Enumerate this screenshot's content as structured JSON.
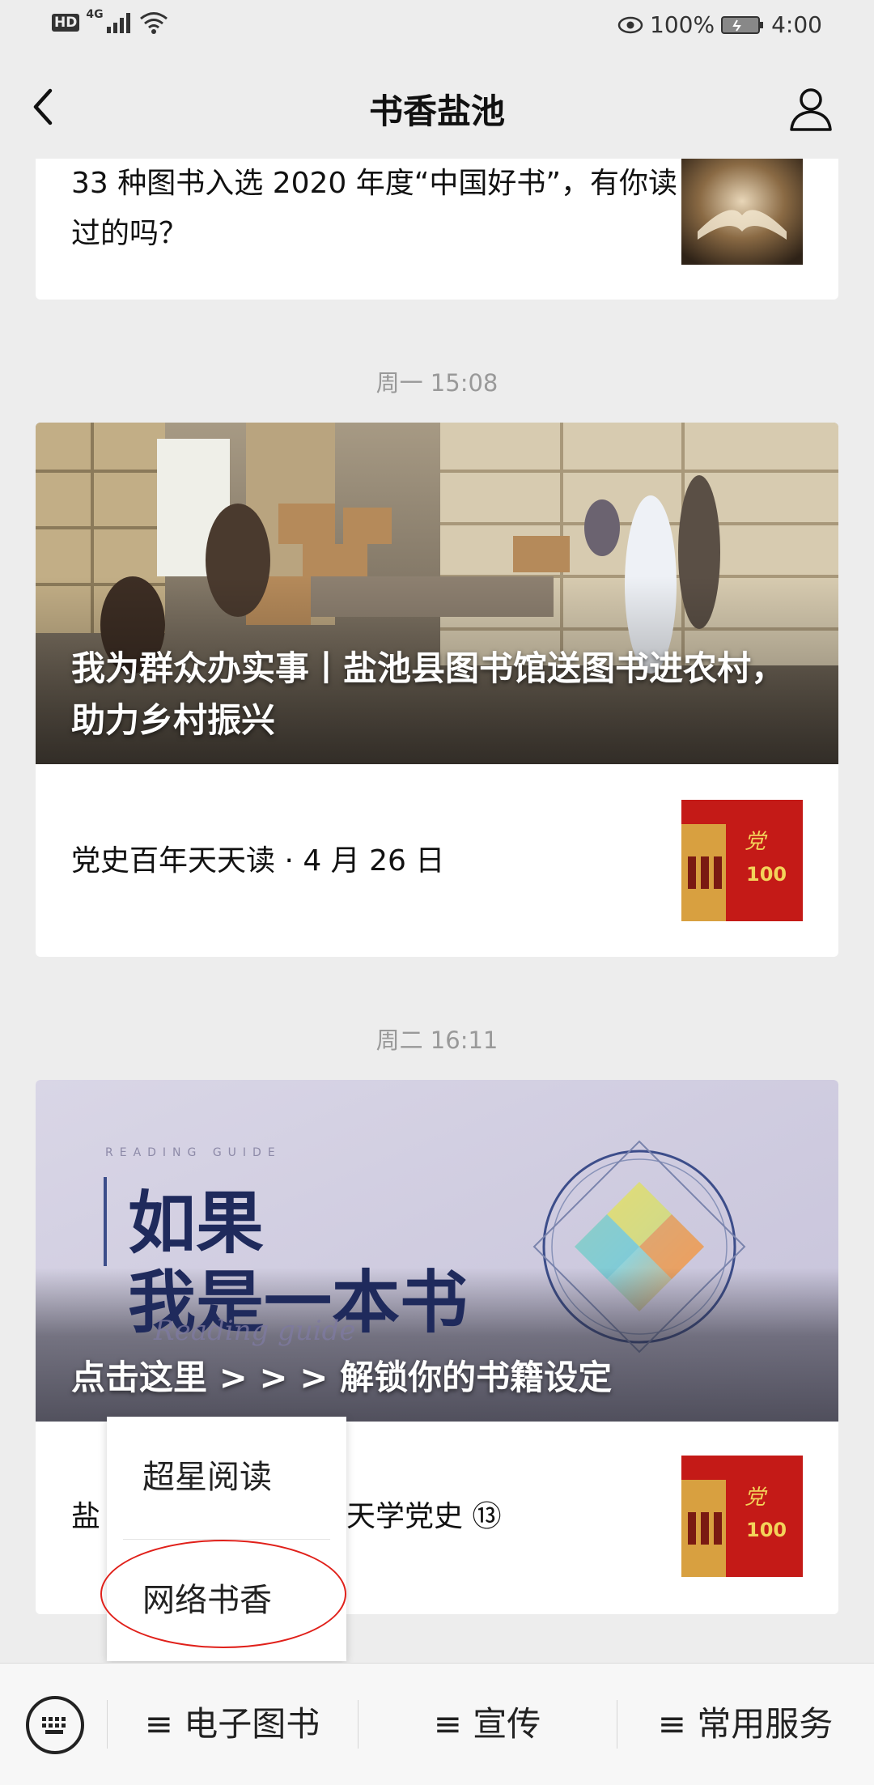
{
  "status_bar": {
    "left_badges": [
      "HD",
      "4G"
    ],
    "battery_percent": "100%",
    "time": "4:00",
    "icons": [
      "signal-icon",
      "wifi-icon",
      "eye-icon",
      "battery-icon"
    ]
  },
  "nav": {
    "title": "书香盐池",
    "back_icon": "back-arrow-icon",
    "profile_icon": "user-profile-icon"
  },
  "feed": {
    "article_top": {
      "title": "33 种图书入选 2020 年度“中国好书”，有你读过的吗？"
    },
    "group_1": {
      "time": "周一 15:08",
      "hero_title": "我为群众办实事丨盐池县图书馆送图书进农村，助力乡村振兴",
      "item_title": "党史百年天天读 · 4 月 26 日"
    },
    "group_2": {
      "time": "周二 16:11",
      "hero_small": "READING GUIDE",
      "hero_big_line1": "如果",
      "hero_big_line2": "我是一本书",
      "hero_script": "Reading guide",
      "hero_title": "点击这里 > > > 解锁你的书籍设定",
      "item_title_visible": "盐",
      "item_title_tail": "天学党史 ⑬"
    }
  },
  "popup_menu": {
    "items": [
      "超星阅读",
      "网络书香"
    ]
  },
  "bottom_bar": {
    "keyboard_icon": "keyboard-icon",
    "menus": [
      "≡ 电子图书",
      "≡ 宣传",
      "≡ 常用服务"
    ]
  },
  "colors": {
    "background": "#ededed",
    "highlight_oval": "#e0201a"
  }
}
